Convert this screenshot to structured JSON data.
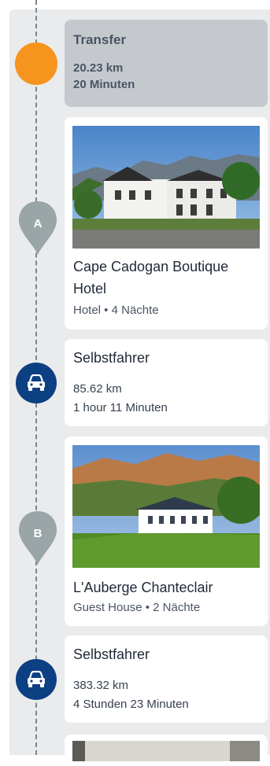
{
  "transfer": {
    "title": "Transfer",
    "distance": "20.23 km",
    "duration": "20 Minuten"
  },
  "stops": [
    {
      "marker": "A",
      "name_line1": "Cape Cadogan Boutique",
      "name_line2": "Hotel",
      "meta": "Hotel • 4 Nächte"
    },
    {
      "marker": "B",
      "name_line1": "L'Auberge Chanteclair",
      "meta": "Guest House • 2 Nächte"
    }
  ],
  "drives": [
    {
      "title": "Selbstfahrer",
      "distance": "85.62 km",
      "duration": "1 hour 11 Minuten"
    },
    {
      "title": "Selbstfahrer",
      "distance": "383.32 km",
      "duration": "4 Stunden 23 Minuten"
    }
  ],
  "colors": {
    "panel_bg": "#e9ebed",
    "transfer_card": "#c5c9ce",
    "transfer_marker": "#f7941d",
    "pin_marker": "#9aa5a8",
    "car_marker": "#0d3f83"
  },
  "icons": {
    "transfer": "orange-circle-icon",
    "stop": "map-pin-icon",
    "drive": "car-icon"
  }
}
